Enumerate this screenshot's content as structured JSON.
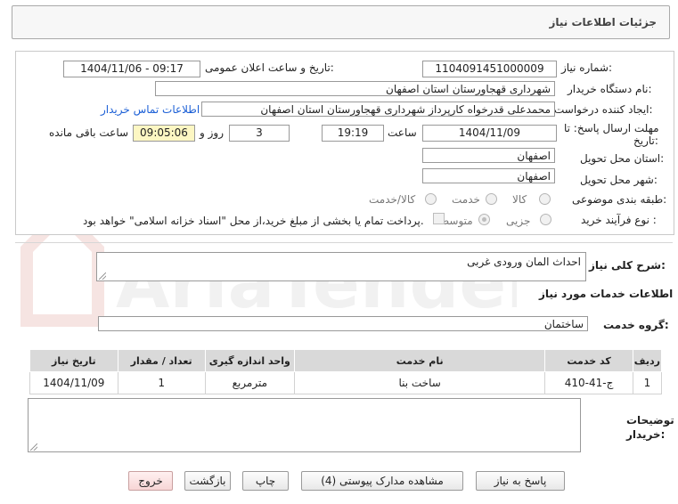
{
  "header": {
    "title": "جزئیات اطلاعات نیاز"
  },
  "fields": {
    "need_number_label": "شماره نیاز:",
    "need_number": "1104091451000009",
    "announce_label": "تاریخ و ساعت اعلان عمومی:",
    "announce_value": "1404/11/06 - 09:17",
    "buyer_label": "نام دستگاه خریدار:",
    "buyer_value": "شهرداری قهجاورستان استان اصفهان",
    "creator_label": "ایجاد کننده درخواست:",
    "creator_value": "محمدعلی قدرخواه کارپرداز شهرداری قهجاورستان استان اصفهان",
    "contact_link": "اطلاعات تماس خریدار",
    "deadline_label_1": "مهلت ارسال پاسخ: تا",
    "deadline_label_2": "تاریخ:",
    "deadline_date": "1404/11/09",
    "time_label": "ساعت",
    "deadline_time": "19:19",
    "days_value": "3",
    "days_label": "روز و",
    "remaining_time": "09:05:06",
    "remaining_label": "ساعت باقی مانده",
    "province_label": "استان محل تحویل:",
    "province_value": "اصفهان",
    "city_label": "شهر محل تحویل:",
    "city_value": "اصفهان",
    "category_label": "طبقه بندی موضوعی:",
    "category_options": [
      "کالا",
      "خدمت",
      "کالا/خدمت"
    ],
    "process_label": "نوع فرآیند خرید :",
    "process_options": [
      "جزیی",
      "متوسط"
    ],
    "payment_note": "پرداخت تمام یا بخشی از مبلغ خرید،از محل \"اسناد خزانه اسلامی\" خواهد بود."
  },
  "summary": {
    "label": "شرح کلی نیاز:",
    "value": "احداث المان ورودی غربی"
  },
  "services_section": {
    "title": "اطلاعات خدمات مورد نیاز",
    "group_label": "گروه خدمت:",
    "group_value": "ساختمان"
  },
  "table": {
    "headers": [
      "ردیف",
      "کد خدمت",
      "نام خدمت",
      "واحد اندازه گیری",
      "تعداد / مقدار",
      "تاریخ نیاز"
    ],
    "rows": [
      [
        "1",
        "ج-41-410",
        "ساخت بنا",
        "مترمربع",
        "1",
        "1404/11/09"
      ]
    ]
  },
  "notes": {
    "label_1": "توضیحات",
    "label_2": "خریدار:",
    "value": ""
  },
  "buttons": {
    "reply": "پاسخ به نیاز",
    "attachments": "مشاهده مدارک پیوستی (4)",
    "print": "چاپ",
    "back": "بازگشت",
    "exit": "خروج"
  },
  "watermark": {
    "text": "AriaTender.net"
  },
  "colors": {
    "link": "#1b5fd6",
    "remaining_bg": "#fdf7c3",
    "exit_bg": "#f7d6d6"
  }
}
